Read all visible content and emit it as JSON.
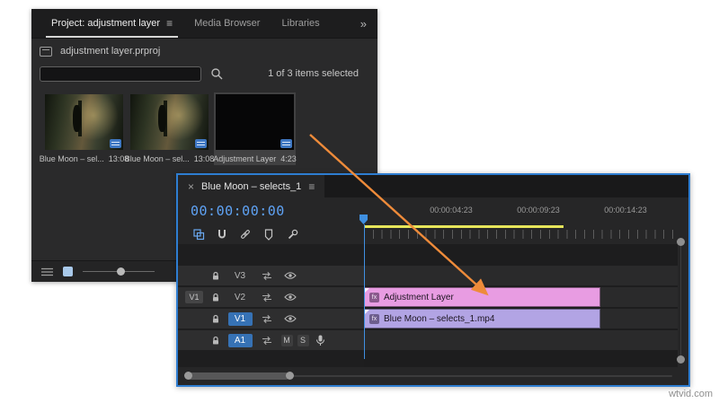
{
  "watermark": "wtvid.com",
  "colors": {
    "panel_border_blue": "#2e7dd1",
    "timecode_blue": "#5fa3f5",
    "render_bar_yellow": "#e6e55a",
    "arrow_orange": "#ee8b3a",
    "clip_pink": "#e89ce2",
    "clip_purple": "#b2a4e4",
    "target_track_blue": "#3672b5"
  },
  "project_panel": {
    "tabs": [
      {
        "label": "Project: adjustment layer"
      },
      {
        "label": "Media Browser"
      },
      {
        "label": "Libraries"
      }
    ],
    "panel_menu_icon": "≡",
    "overflow_chevron": "»",
    "breadcrumb": "adjustment layer.prproj",
    "search_placeholder": "",
    "status": "1 of 3 items selected",
    "items": [
      {
        "name": "Blue Moon – sel...",
        "duration": "13:08"
      },
      {
        "name": "Blue Moon – sel...",
        "duration": "13:08"
      },
      {
        "name": "Adjustment Layer",
        "duration": "4:23"
      }
    ]
  },
  "timeline": {
    "tab": {
      "close": "×",
      "label": "Blue Moon – selects_1",
      "menu": "≡"
    },
    "timecode": "00:00:00:00",
    "ruler_labels": [
      "00:00:04:23",
      "00:00:09:23",
      "00:00:14:23"
    ],
    "tracks": [
      {
        "name": "V3",
        "source": ""
      },
      {
        "name": "V2",
        "source": "V1"
      },
      {
        "name": "V1",
        "source": ""
      },
      {
        "name": "A1",
        "source": "",
        "mute": "M",
        "solo": "S"
      }
    ],
    "clips": [
      {
        "label": "Adjustment Layer",
        "badge": "fx"
      },
      {
        "label": "Blue Moon – selects_1.mp4",
        "badge": "fx"
      }
    ]
  }
}
